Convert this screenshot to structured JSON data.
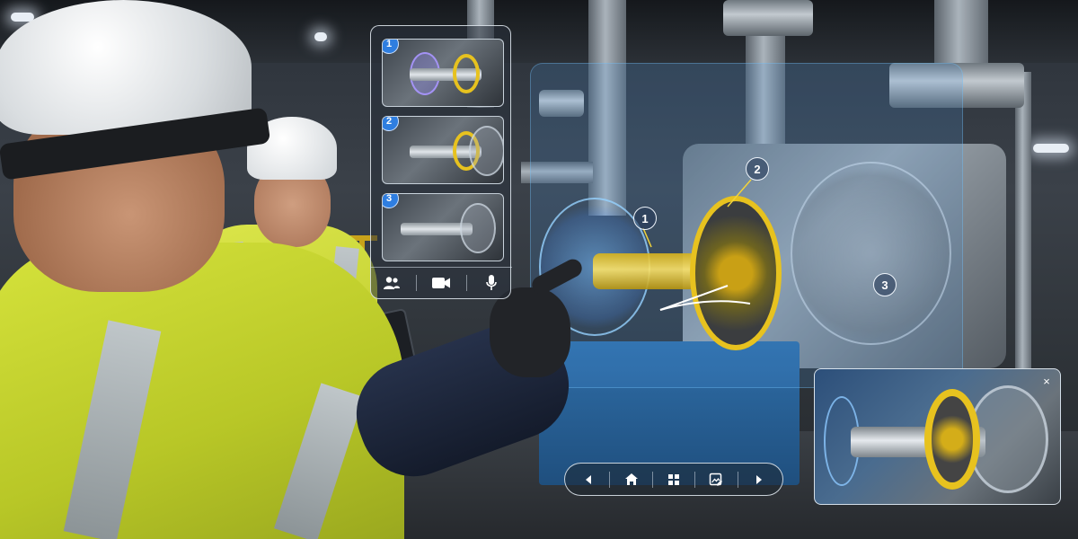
{
  "steps": [
    {
      "number": "1",
      "image": "disassembly-step-1"
    },
    {
      "number": "2",
      "image": "disassembly-step-2"
    },
    {
      "number": "3",
      "image": "disassembly-step-3"
    }
  ],
  "callouts": [
    {
      "number": "1"
    },
    {
      "number": "2"
    },
    {
      "number": "3"
    }
  ],
  "panel_tools": [
    "people-icon",
    "video-camera-icon",
    "microphone-icon"
  ],
  "nav": [
    "chevron-left-icon",
    "home-icon",
    "grid-icon",
    "image-edit-icon",
    "chevron-right-icon"
  ],
  "preview": {
    "close_label": "×"
  },
  "colors": {
    "accent_blue": "#2f7ee0",
    "highlight_yellow": "#e7c21f",
    "overlay_border": "#e6eef6"
  }
}
